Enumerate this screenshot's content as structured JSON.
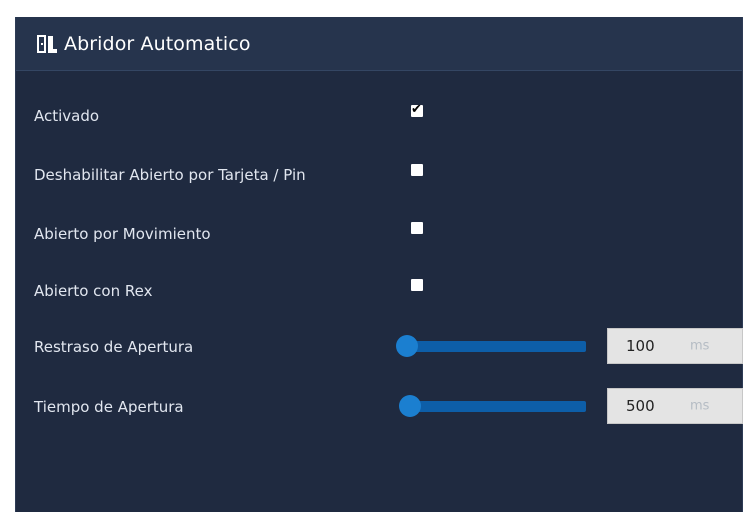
{
  "header": {
    "title": "Abridor Automatico",
    "icon": "door-icon"
  },
  "options": [
    {
      "label": "Activado",
      "checked": true
    },
    {
      "label": "Deshabilitar Abierto por Tarjeta / Pin",
      "checked": false
    },
    {
      "label": "Abierto por Movimiento",
      "checked": false
    },
    {
      "label": "Abierto con Rex",
      "checked": false
    }
  ],
  "sliders": [
    {
      "label": "Restraso de Apertura",
      "value": "100",
      "unit": "ms"
    },
    {
      "label": "Tiempo de Apertura",
      "value": "500",
      "unit": "ms"
    }
  ],
  "colors": {
    "panel_bg": "#1f2a40",
    "header_bg": "#26344d",
    "slider_track": "#0d5ea8",
    "slider_thumb": "#1b7fd0"
  }
}
